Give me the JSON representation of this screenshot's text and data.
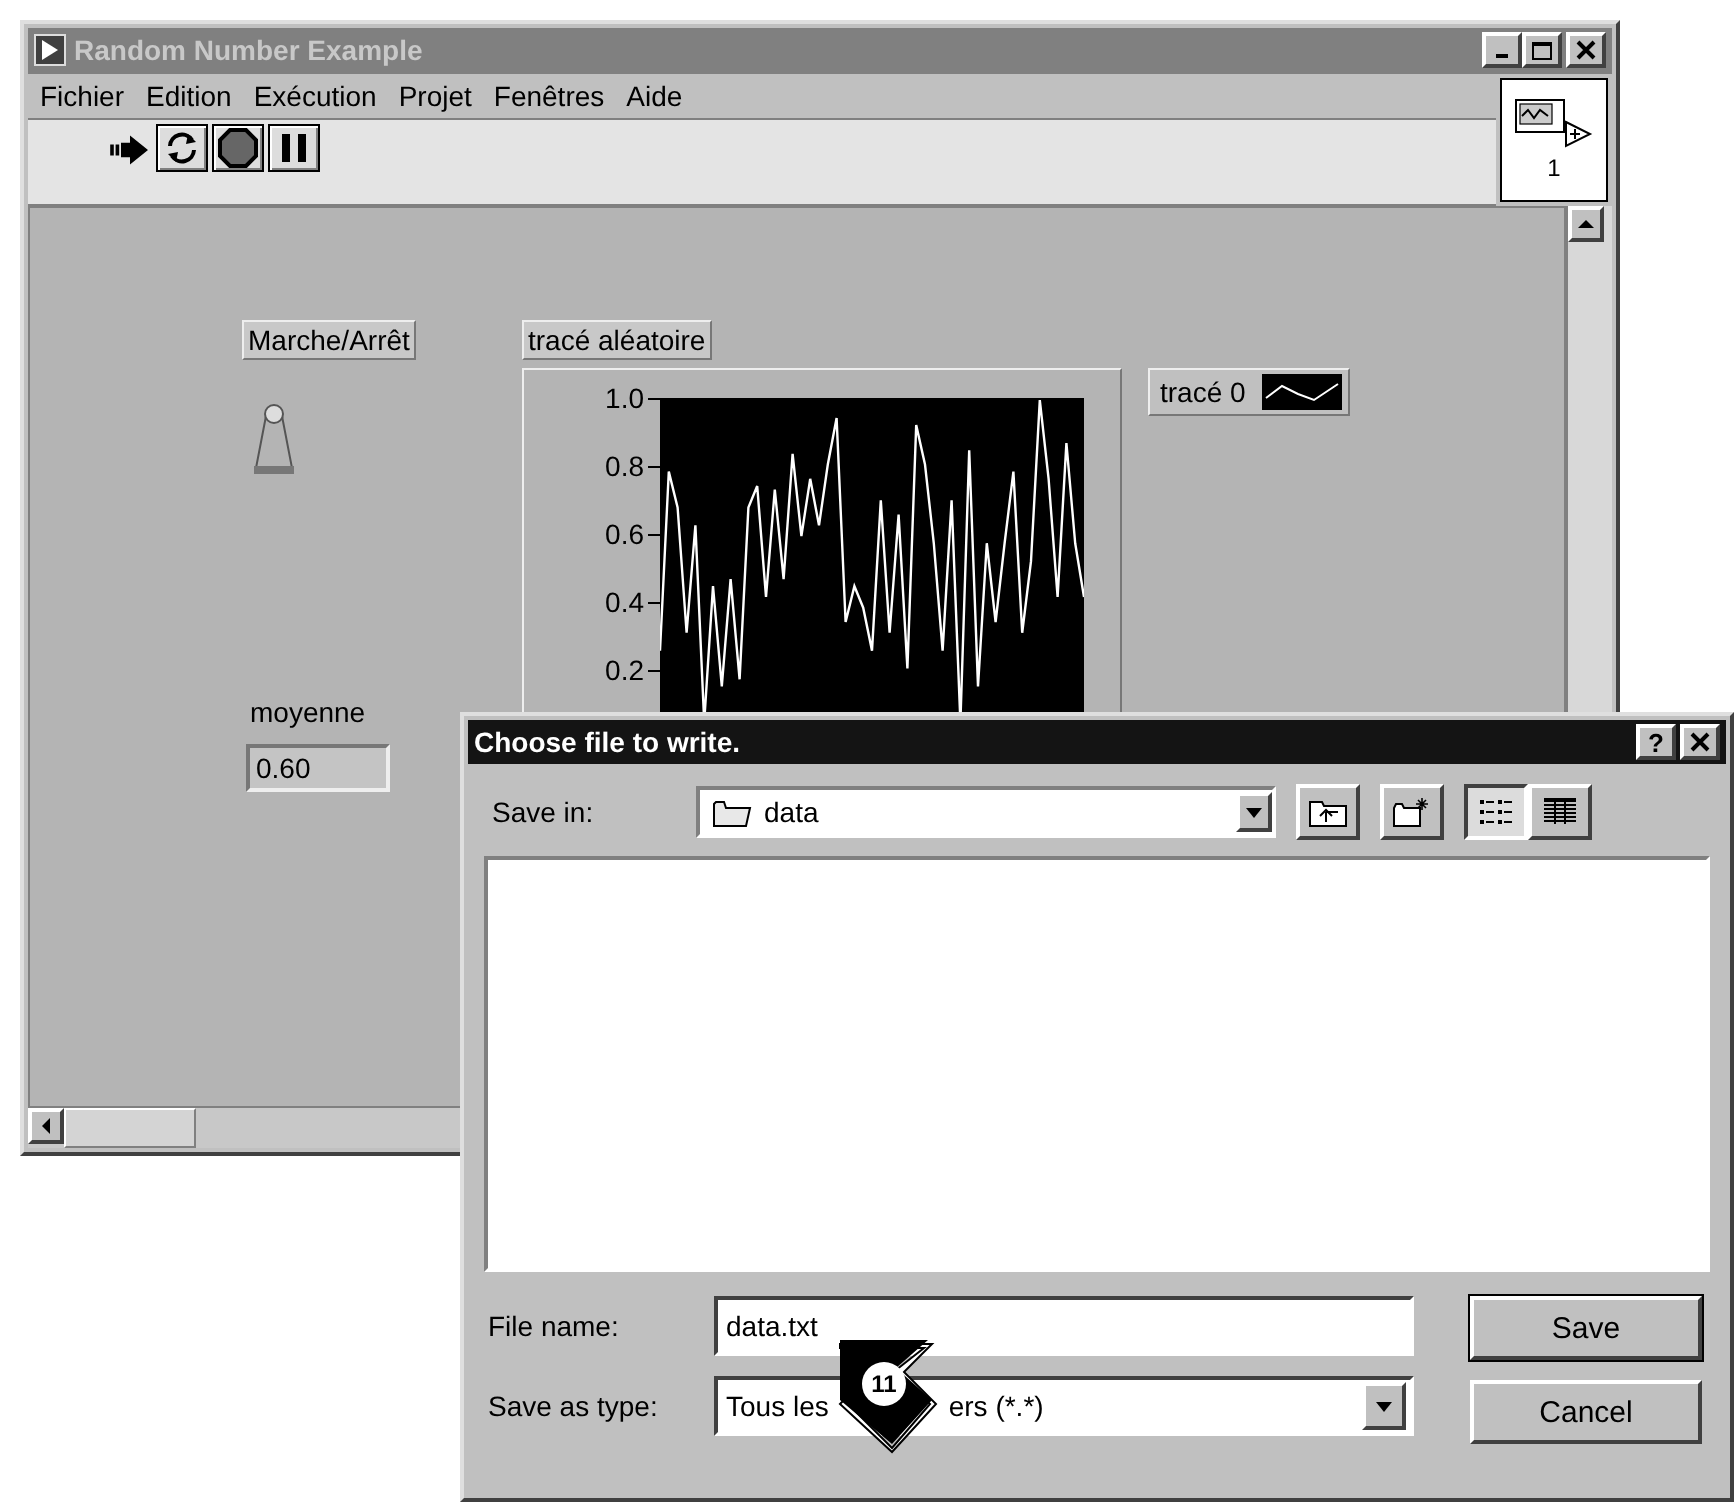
{
  "main_window": {
    "title": "Random Number Example",
    "menu": [
      "Fichier",
      "Edition",
      "Exécution",
      "Projet",
      "Fenêtres",
      "Aide"
    ],
    "connector_pane": {
      "label": "1"
    },
    "front_panel": {
      "switch": {
        "label": "Marche/Arrêt",
        "on": false
      },
      "chart": {
        "label": "tracé aléatoire",
        "y_ticks": [
          "1.0",
          "0.8",
          "0.6",
          "0.4",
          "0.2"
        ],
        "legend": {
          "label": "tracé 0"
        }
      },
      "indicator": {
        "label": "moyenne",
        "value": "0.60"
      }
    }
  },
  "dialog": {
    "title": "Choose file to write.",
    "help_button": "?",
    "save_in": {
      "label": "Save in:",
      "value": "data"
    },
    "view_buttons": [
      {
        "selected": true
      },
      {
        "selected": false
      }
    ],
    "file_name": {
      "label": "File name:",
      "value": "data.txt"
    },
    "save_as_type": {
      "label": "Save as type:",
      "value_parts": [
        "Tous les",
        "ers (*.*)"
      ]
    },
    "buttons": [
      {
        "label": "Save",
        "default": true
      },
      {
        "label": "Cancel",
        "default": false
      }
    ]
  },
  "callout": {
    "number": "11"
  }
}
